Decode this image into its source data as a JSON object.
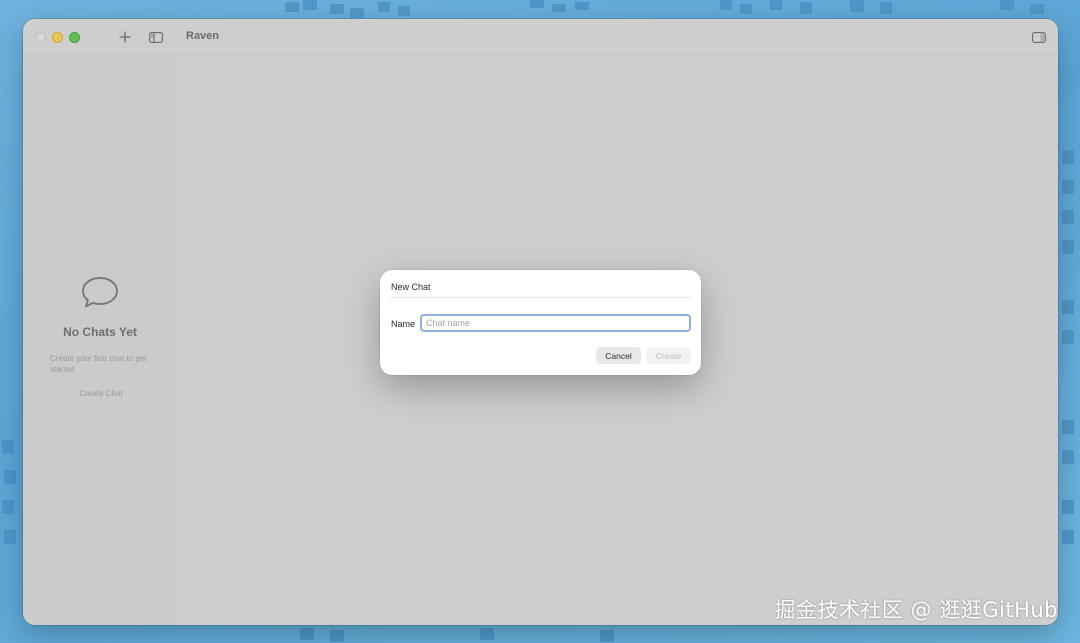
{
  "window": {
    "title": "Raven",
    "toolbar": {
      "new_icon": "plus-icon",
      "sidebar_icon": "sidebar-toggle-icon",
      "inspector_icon": "inspector-toggle-icon"
    }
  },
  "sidebar": {
    "empty_icon": "chat-bubble-icon",
    "empty_title": "No Chats Yet",
    "empty_subtitle": "Create your first chat to get started",
    "create_link": "Create Chat"
  },
  "dialog": {
    "title": "New Chat",
    "name_label": "Name",
    "name_placeholder": "Chat name",
    "name_value": "",
    "cancel_label": "Cancel",
    "create_label": "Create"
  },
  "watermark": "掘金技术社区 @ 逛逛GitHub",
  "colors": {
    "desktop": "#5aa6d6",
    "window_dim": "#cecece",
    "dialog_bg": "#ffffff",
    "focus_ring": "#8fb0e2"
  }
}
